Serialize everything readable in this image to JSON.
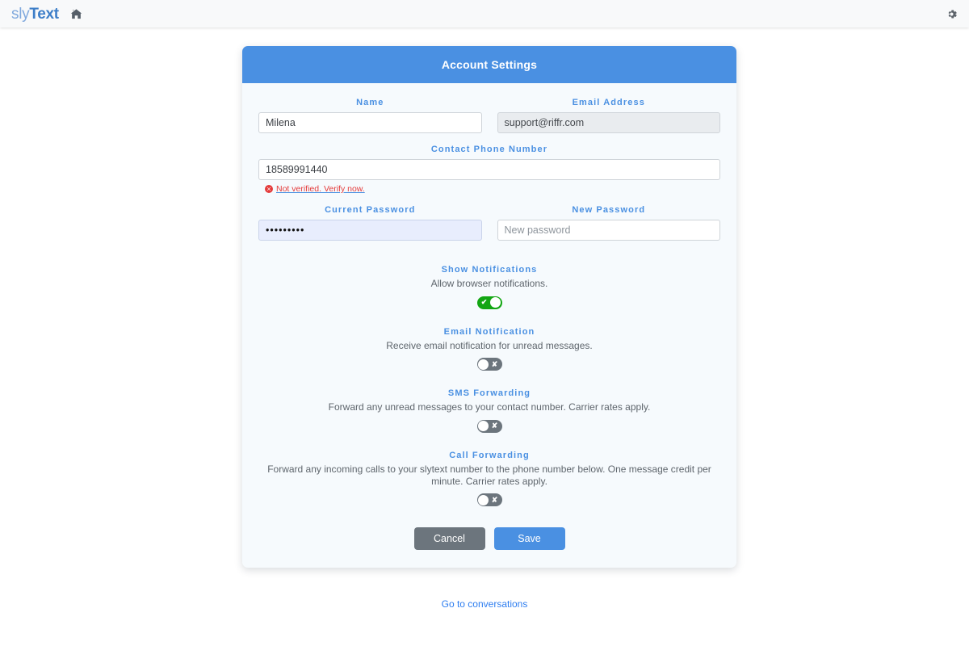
{
  "navbar": {
    "brand_prefix": "sly",
    "brand_suffix": "Text",
    "home_icon_name": "home-icon",
    "gear_icon_name": "gear-icon"
  },
  "card": {
    "title": "Account Settings"
  },
  "form": {
    "name": {
      "label": "Name",
      "value": "Milena",
      "placeholder": "Name"
    },
    "email": {
      "label": "Email Address",
      "value": "support@riffr.com",
      "placeholder": "Email Address"
    },
    "phone": {
      "label": "Contact Phone Number",
      "value": "18589991440",
      "placeholder": "Contact Phone Number",
      "verify_text": "Not verified. Verify now."
    },
    "current_password": {
      "label": "Current Password",
      "value": "•••••••••",
      "placeholder": "Current password"
    },
    "new_password": {
      "label": "New Password",
      "value": "",
      "placeholder": "New password"
    }
  },
  "toggles": [
    {
      "label": "Show Notifications",
      "description": "Allow browser notifications.",
      "state": "on",
      "mark": "✔"
    },
    {
      "label": "Email Notification",
      "description": "Receive email notification for unread messages.",
      "state": "off",
      "mark": "✘"
    },
    {
      "label": "SMS Forwarding",
      "description": "Forward any unread messages to your contact number. Carrier rates apply.",
      "state": "off",
      "mark": "✘"
    },
    {
      "label": "Call Forwarding",
      "description": "Forward any incoming calls to your slytext number to the phone number below. One message credit per minute. Carrier rates apply.",
      "state": "off",
      "mark": "✘"
    }
  ],
  "buttons": {
    "cancel": "Cancel",
    "save": "Save"
  },
  "footer": {
    "link": "Go to conversations"
  },
  "colors": {
    "accent": "#4a90e2",
    "header": "#4a90e2",
    "toggle_on": "#13a613",
    "toggle_off": "#6c757d",
    "danger": "#e43b3b",
    "cancel": "#6c757d",
    "card_body": "#f6fafd",
    "navbar": "#f8f9fa"
  }
}
